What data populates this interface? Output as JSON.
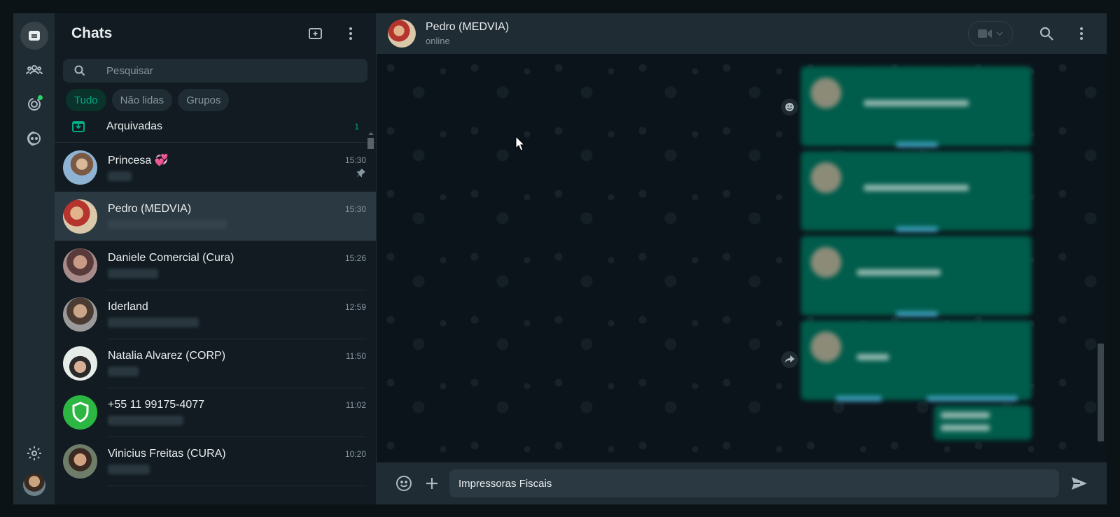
{
  "sidebar_rail": {
    "icons": [
      "chats-icon",
      "communities-icon",
      "status-icon",
      "channels-icon"
    ],
    "bottom_icons": [
      "settings-icon",
      "profile-avatar"
    ]
  },
  "chat_list": {
    "title": "Chats",
    "search_placeholder": "Pesquisar",
    "filters": [
      "Tudo",
      "Não lidas",
      "Grupos"
    ],
    "active_filter": "Tudo",
    "archived": {
      "label": "Arquivadas",
      "count": "1"
    },
    "chats": [
      {
        "name": "Princesa 💞",
        "time": "15:30",
        "pinned": true
      },
      {
        "name": "Pedro (MEDVIA)",
        "time": "15:30",
        "selected": true
      },
      {
        "name": "Daniele Comercial (Cura)",
        "time": "15:26"
      },
      {
        "name": "Iderland",
        "time": "12:59"
      },
      {
        "name": "Natalia Alvarez (CORP)",
        "time": "11:50"
      },
      {
        "name": "+55 11 99175-4077",
        "time": "11:02"
      },
      {
        "name": "Vinicius Freitas (CURA)",
        "time": "10:20"
      }
    ]
  },
  "conversation": {
    "contact_name": "Pedro (MEDVIA)",
    "status": "online",
    "composer_text": "Impressoras Fiscais"
  },
  "colors": {
    "accent": "#00a884",
    "bubble_out": "#005c4b",
    "panel": "#202c33",
    "background": "#111b21"
  }
}
